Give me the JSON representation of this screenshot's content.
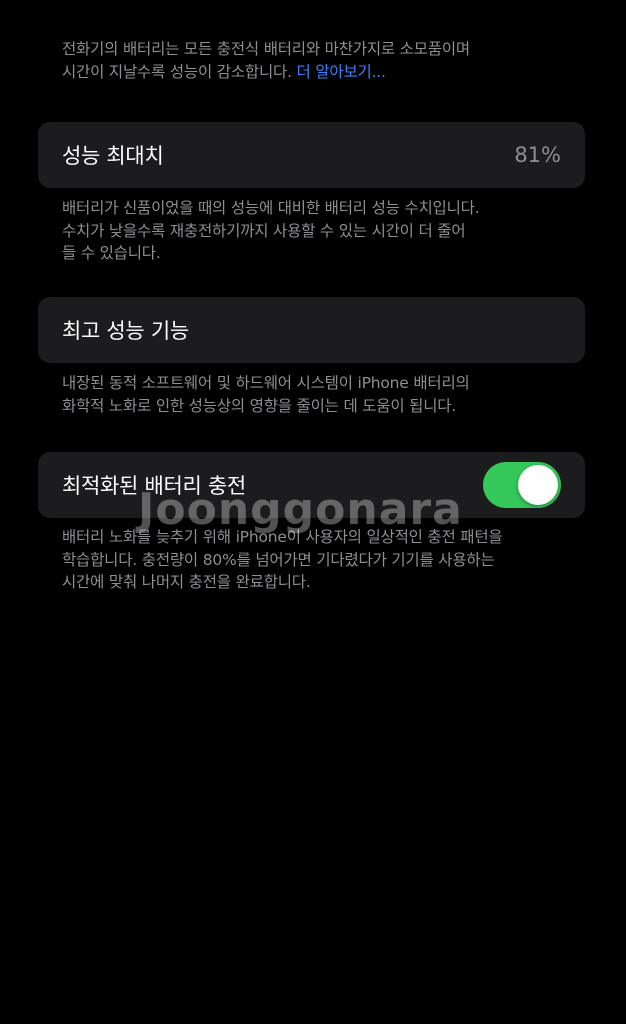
{
  "intro": {
    "text_line1": "전화기의 배터리는 모든 충전식 배터리와 마찬가지로 소모품이며",
    "text_line2": "시간이 지날수록 성능이 감소합니다. ",
    "learn_more": "더 알아보기..."
  },
  "max_capacity": {
    "label": "성능 최대치",
    "value": "81%",
    "footnote_line1": "배터리가 신품이었을 때의 성능에 대비한 배터리 성능 수치입니다.",
    "footnote_line2": "수치가 낮을수록 재충전하기까지 사용할 수 있는 시간이 더 줄어",
    "footnote_line3": "들 수 있습니다."
  },
  "peak_performance": {
    "label": "최고 성능 기능",
    "footnote_line1": "내장된 동적 소프트웨어 및 하드웨어 시스템이 iPhone 배터리의",
    "footnote_line2": "화학적 노화로 인한 성능상의 영향을 줄이는 데 도움이 됩니다."
  },
  "optimized_charging": {
    "label": "최적화된 배터리 충전",
    "enabled": true,
    "footnote_line1": "배터리 노화를 늦추기 위해 iPhone이 사용자의 일상적인 충전 패턴을",
    "footnote_line2": "학습합니다. 충전량이 80%를 넘어가면 기다렸다가 기기를 사용하는",
    "footnote_line3": "시간에 맞춰 나머지 충전을 완료합니다."
  },
  "watermark": "Joonggonara",
  "colors": {
    "background": "#000000",
    "cell": "#1c1c1e",
    "secondary_text": "#8e8e93",
    "link": "#3b82f6",
    "toggle_on": "#34c759"
  }
}
